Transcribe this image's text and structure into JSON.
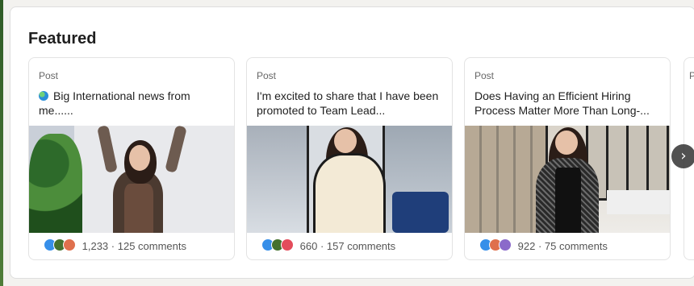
{
  "section": {
    "title": "Featured"
  },
  "cards": [
    {
      "kind": "Post",
      "text": "Big International news from me......",
      "icon": "globe-icon",
      "reactions": [
        "like",
        "celebrate",
        "support"
      ],
      "count": "1,233",
      "comments": "125 comments"
    },
    {
      "kind": "Post",
      "text": "I'm excited to share that I have been promoted to Team Lead...",
      "reactions": [
        "like",
        "celebrate",
        "love"
      ],
      "count": "660",
      "comments": "157 comments"
    },
    {
      "kind": "Post",
      "text": "Does Having an Efficient Hiring Process Matter More Than Long-...",
      "reactions": [
        "like",
        "support",
        "insight"
      ],
      "count": "922",
      "comments": "75 comments"
    }
  ],
  "partial_card": {
    "kind": "P"
  },
  "carousel": {
    "next_icon": "chevron-right-icon",
    "next_symbol": "›"
  },
  "colors": {
    "like": "#378fe9",
    "celebrate": "#44712e",
    "support": "#df704d",
    "love": "#e34c5b",
    "insight": "#8b6aca"
  }
}
